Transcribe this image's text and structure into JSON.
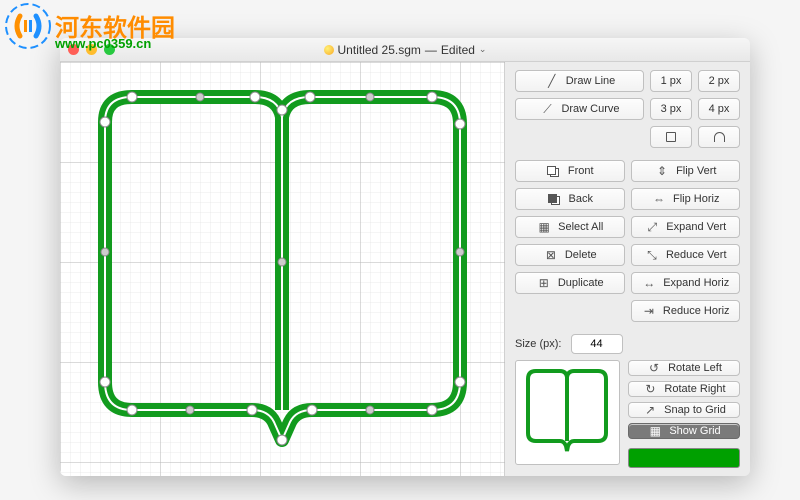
{
  "watermark": {
    "text": "河东软件园",
    "url": "www.pc0359.cn"
  },
  "window": {
    "title": "Untitled 25.sgm",
    "edited_label": "Edited"
  },
  "tools": {
    "draw_line": "Draw Line",
    "draw_curve": "Draw Curve",
    "px1": "1 px",
    "px2": "2 px",
    "px3": "3 px",
    "px4": "4 px"
  },
  "edit": {
    "front": "Front",
    "back": "Back",
    "select_all": "Select All",
    "delete": "Delete",
    "duplicate": "Duplicate",
    "flip_vert": "Flip Vert",
    "flip_horiz": "Flip Horiz",
    "expand_vert": "Expand Vert",
    "reduce_vert": "Reduce Vert",
    "expand_horiz": "Expand Horiz",
    "reduce_horiz": "Reduce Horiz"
  },
  "transform": {
    "rotate_left": "Rotate Left",
    "rotate_right": "Rotate Right",
    "snap_to_grid": "Snap to Grid",
    "show_grid": "Show Grid"
  },
  "size": {
    "label": "Size (px):",
    "value": "44"
  },
  "colors": {
    "shape": "#00a000",
    "accent": "#129b1e"
  }
}
